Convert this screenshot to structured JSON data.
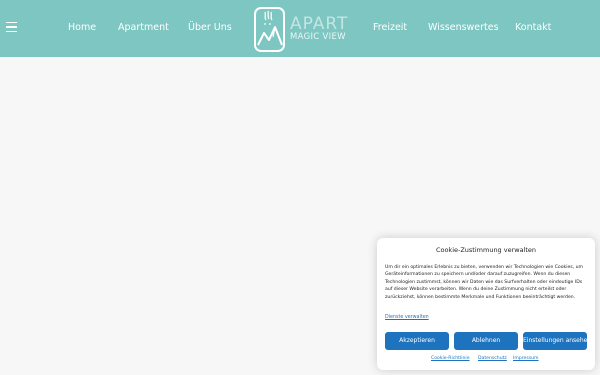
{
  "nav": {
    "items": [
      "Home",
      "Apartment",
      "Über Uns",
      "Freizeit",
      "Wissenswertes",
      "Kontakt"
    ]
  },
  "logo": {
    "line1": "APART",
    "line2": "MAGIC VIEW"
  },
  "cookie": {
    "title": "Cookie-Zustimmung verwalten",
    "body": "Um dir ein optimales Erlebnis zu bieten, verwenden wir Technologien wie Cookies, um Geräteinformationen zu speichern und/oder darauf zuzugreifen. Wenn du diesen Technologien zustimmst, können wir Daten wie das Surfverhalten oder eindeutige IDs auf dieser Website verarbeiten. Wenn du deine Zustimmung nicht erteilst oder zurückziehst, können bestimmte Merkmale und Funktionen beeinträchtigt werden.",
    "manage_link": "Dienste verwalten",
    "accept": "Akzeptieren",
    "decline": "Ablehnen",
    "settings": "Einstellungen ansehen",
    "footer_links": [
      "Cookie-Richtlinie",
      "Datenschutz",
      "Impressum"
    ]
  },
  "colors": {
    "navbar": "#7dc6c2",
    "button": "#1e73be",
    "background": "#f7f7f7"
  },
  "icons": {
    "menu": "hamburger-icon",
    "logo": "mountain-logo-icon"
  }
}
